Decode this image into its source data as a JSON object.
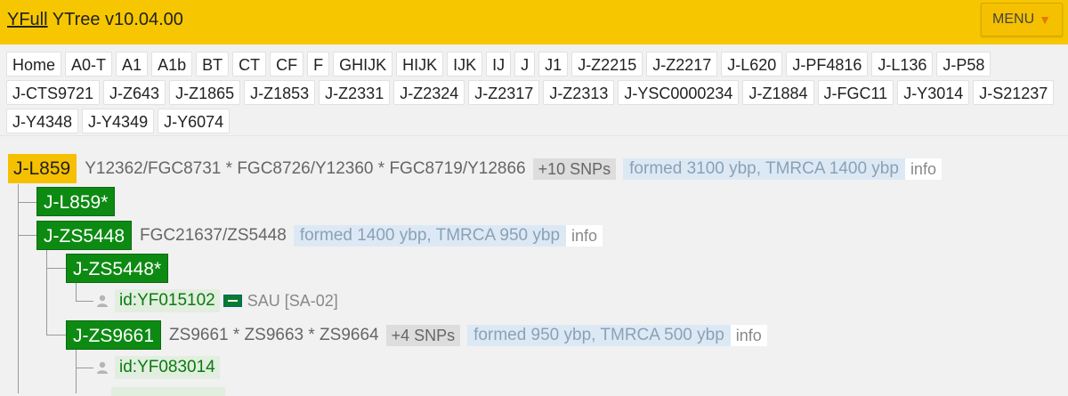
{
  "header": {
    "brand_link": "YFull",
    "brand_rest": "YTree v10.04.00",
    "menu_label": "MENU",
    "menu_arrow": "▼"
  },
  "tabs": [
    "Home",
    "A0-T",
    "A1",
    "A1b",
    "BT",
    "CT",
    "CF",
    "F",
    "GHIJK",
    "HIJK",
    "IJK",
    "IJ",
    "J",
    "J1",
    "J-Z2215",
    "J-Z2217",
    "J-L620",
    "J-PF4816",
    "J-L136",
    "J-P58",
    "J-CTS9721",
    "J-Z643",
    "J-Z1865",
    "J-Z1853",
    "J-Z2331",
    "J-Z2324",
    "J-Z2317",
    "J-Z2313",
    "J-YSC0000234",
    "J-Z1884",
    "J-FGC11",
    "J-Y3014",
    "J-S21237",
    "J-Y4348",
    "J-Y4349",
    "J-Y6074"
  ],
  "tree": {
    "root": {
      "name": "J-L859",
      "snps": "Y12362/FGC8731 * FGC8726/Y12360 * FGC8719/Y12866",
      "badge": "+10 SNPs",
      "formed": "formed 3100 ybp, TMRCA 1400 ybp",
      "info": "info"
    },
    "l859_star": {
      "name": "J-L859*"
    },
    "zs5448": {
      "name": "J-ZS5448",
      "snps": "FGC21637/ZS5448",
      "formed": "formed 1400 ybp, TMRCA 950 ybp",
      "info": "info"
    },
    "zs5448_star": {
      "name": "J-ZS5448*"
    },
    "kit1": {
      "id": "id:YF015102",
      "country": "SAU [SA-02]"
    },
    "zs9661": {
      "name": "J-ZS9661",
      "snps": "ZS9661 * ZS9663 * ZS9664",
      "badge": "+4 SNPs",
      "formed": "formed 950 ybp, TMRCA 500 ybp",
      "info": "info"
    },
    "kit2": {
      "id": "id:YF083014"
    }
  },
  "colors": {
    "header_bg": "#f6c700",
    "root_node_bg": "#f5c000",
    "node_bg": "#0d8a12",
    "kit_text": "#0a7a0f",
    "formed_bg": "#dce9f5"
  }
}
